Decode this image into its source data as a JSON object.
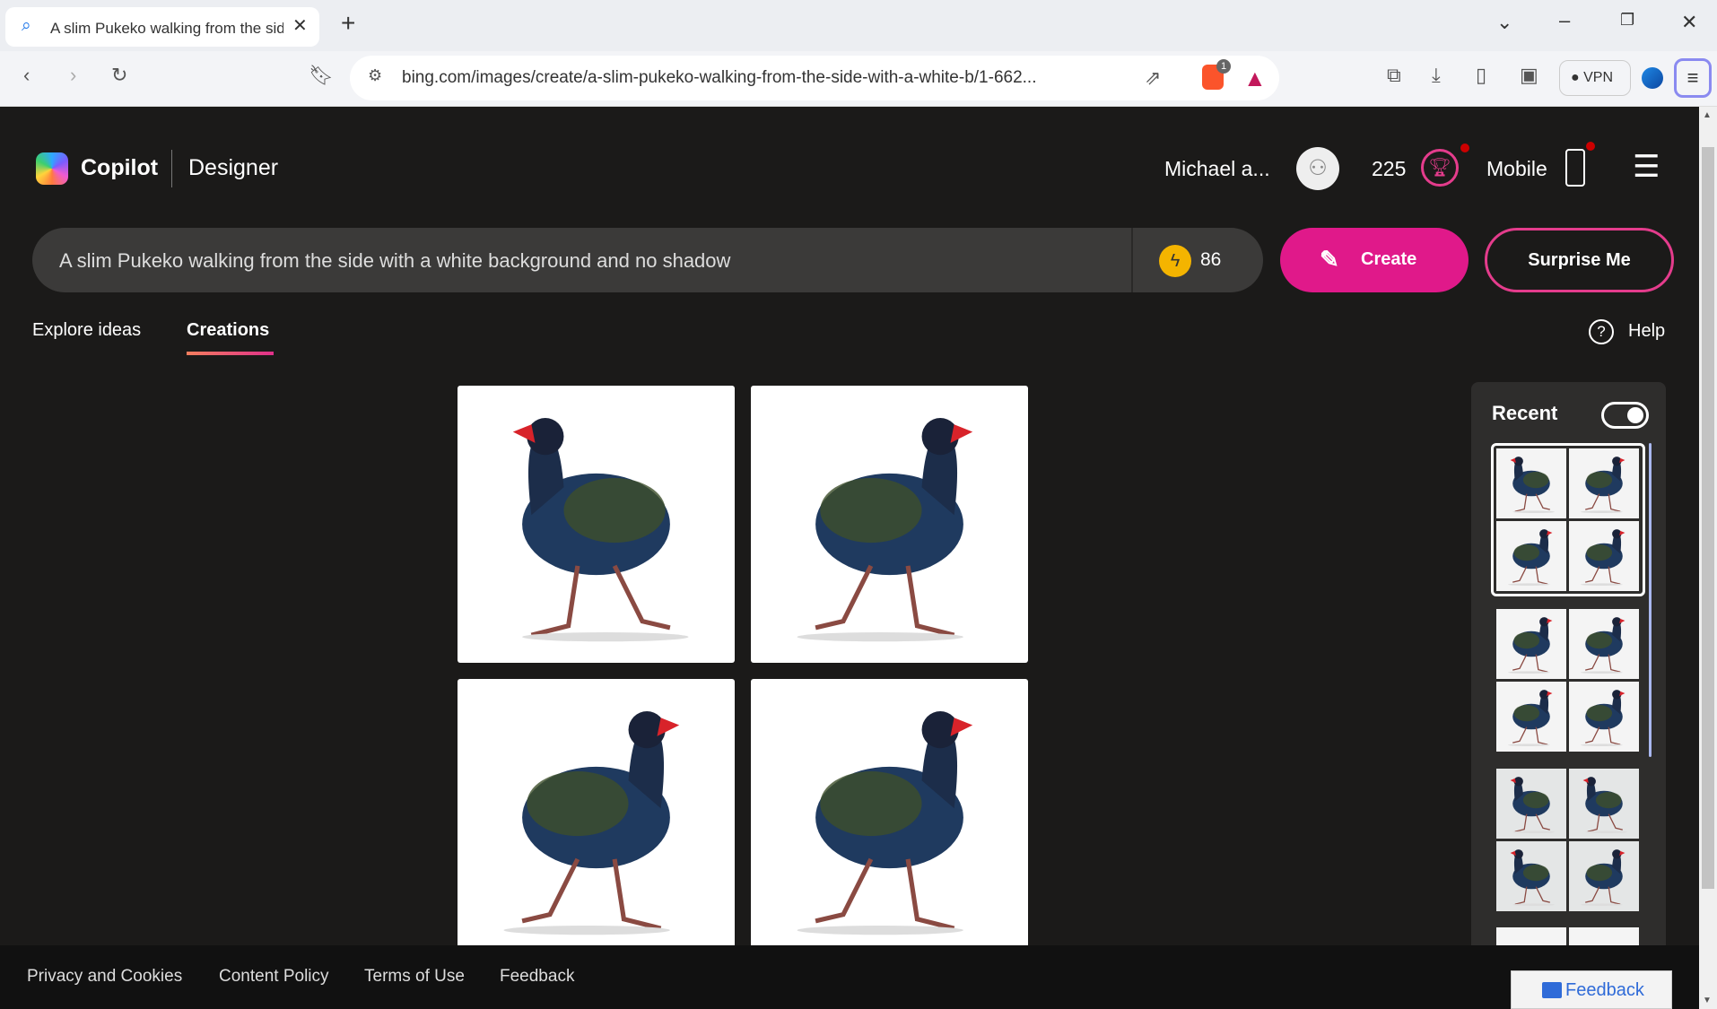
{
  "browser": {
    "tab_title": "A slim Pukeko walking from the side with a white background and no shadow",
    "url": "bing.com/images/create/a-slim-pukeko-walking-from-the-side-with-a-white-b/1-662...",
    "brave_badge": "1",
    "vpn_label": "VPN"
  },
  "header": {
    "brand": "Copilot",
    "product": "Designer",
    "user": "Michael a...",
    "points": "225",
    "mobile_label": "Mobile"
  },
  "search": {
    "prompt": "A slim Pukeko walking from the side with a white background and no shadow",
    "boosts": "86",
    "create_label": "Create",
    "surprise_label": "Surprise Me"
  },
  "tabs": [
    {
      "label": "Explore ideas"
    },
    {
      "label": "Creations",
      "active": true
    }
  ],
  "help_label": "Help",
  "recent": {
    "title": "Recent",
    "toggle_on": true
  },
  "footer": {
    "links": [
      "Privacy and Cookies",
      "Content Policy",
      "Terms of Use",
      "Feedback"
    ],
    "feedback_button": "Feedback"
  },
  "colors": {
    "accent": "#e0198a",
    "background": "#1b1a19"
  }
}
